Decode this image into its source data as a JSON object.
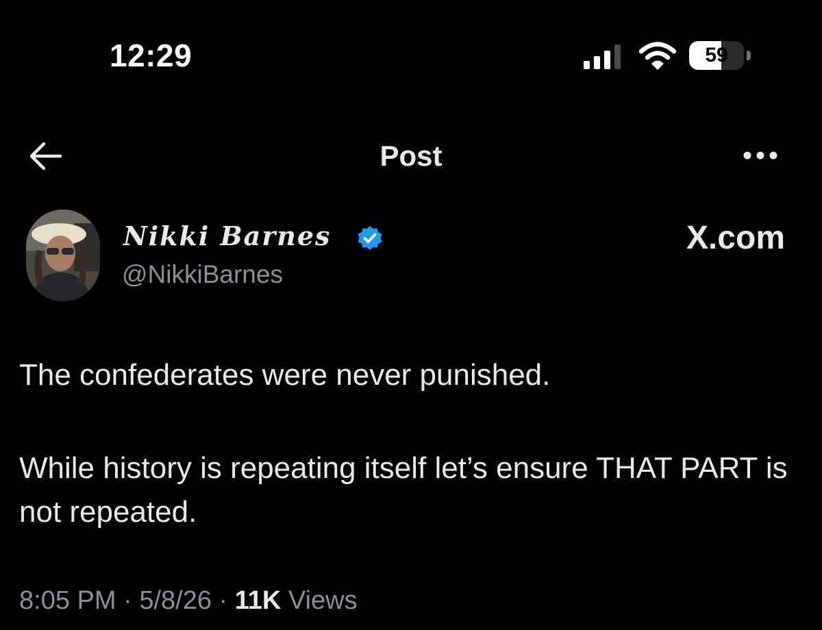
{
  "status_bar": {
    "time": "12:29",
    "battery": "59",
    "battery_level": 0.59
  },
  "nav": {
    "title": "Post"
  },
  "author": {
    "name": "Nikki Barnes",
    "handle": "@NikkiBarnes",
    "verified": true
  },
  "site_label": "X.com",
  "post": {
    "paragraphs": [
      "The confederates were never punished.",
      "While history is repeating itself let’s ensure THAT PART is not repeated."
    ]
  },
  "meta": {
    "time": "8:05 PM",
    "separator": " · ",
    "date": "5/8/26",
    "views_count": "11K",
    "views_label": " Views"
  },
  "colors": {
    "background": "#000000",
    "text_primary": "#e7e9ea",
    "text_secondary": "#8b9096",
    "verified_blue": "#1d9bf0"
  }
}
